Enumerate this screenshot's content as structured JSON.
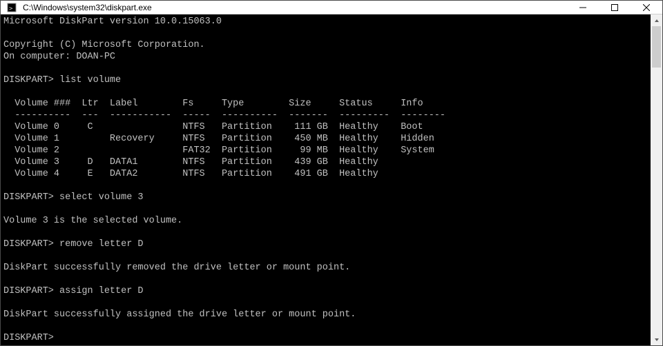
{
  "window": {
    "title": "C:\\Windows\\system32\\diskpart.exe"
  },
  "terminal": {
    "lines": {
      "banner1": "Microsoft DiskPart version 10.0.15063.0",
      "banner2": "Copyright (C) Microsoft Corporation.",
      "banner3": "On computer: DOAN-PC",
      "prompt1": "DISKPART> list volume",
      "table_header": "  Volume ###  Ltr  Label        Fs     Type        Size     Status     Info",
      "table_divider": "  ----------  ---  -----------  -----  ----------  -------  ---------  --------",
      "row0": "  Volume 0     C                NTFS   Partition    111 GB  Healthy    Boot",
      "row1": "  Volume 1         Recovery     NTFS   Partition    450 MB  Healthy    Hidden",
      "row2": "  Volume 2                      FAT32  Partition     99 MB  Healthy    System",
      "row3": "  Volume 3     D   DATA1        NTFS   Partition    439 GB  Healthy",
      "row4": "  Volume 4     E   DATA2        NTFS   Partition    491 GB  Healthy",
      "prompt2": "DISKPART> select volume 3",
      "resp2": "Volume 3 is the selected volume.",
      "prompt3": "DISKPART> remove letter D",
      "resp3": "DiskPart successfully removed the drive letter or mount point.",
      "prompt4": "DISKPART> assign letter D",
      "resp4": "DiskPart successfully assigned the drive letter or mount point.",
      "prompt5": "DISKPART>"
    }
  },
  "chart_data": {
    "type": "table",
    "title": "DISKPART list volume",
    "columns": [
      "Volume ###",
      "Ltr",
      "Label",
      "Fs",
      "Type",
      "Size",
      "Status",
      "Info"
    ],
    "rows": [
      [
        "Volume 0",
        "C",
        "",
        "NTFS",
        "Partition",
        "111 GB",
        "Healthy",
        "Boot"
      ],
      [
        "Volume 1",
        "",
        "Recovery",
        "NTFS",
        "Partition",
        "450 MB",
        "Healthy",
        "Hidden"
      ],
      [
        "Volume 2",
        "",
        "",
        "FAT32",
        "Partition",
        "99 MB",
        "Healthy",
        "System"
      ],
      [
        "Volume 3",
        "D",
        "DATA1",
        "NTFS",
        "Partition",
        "439 GB",
        "Healthy",
        ""
      ],
      [
        "Volume 4",
        "E",
        "DATA2",
        "NTFS",
        "Partition",
        "491 GB",
        "Healthy",
        ""
      ]
    ]
  }
}
